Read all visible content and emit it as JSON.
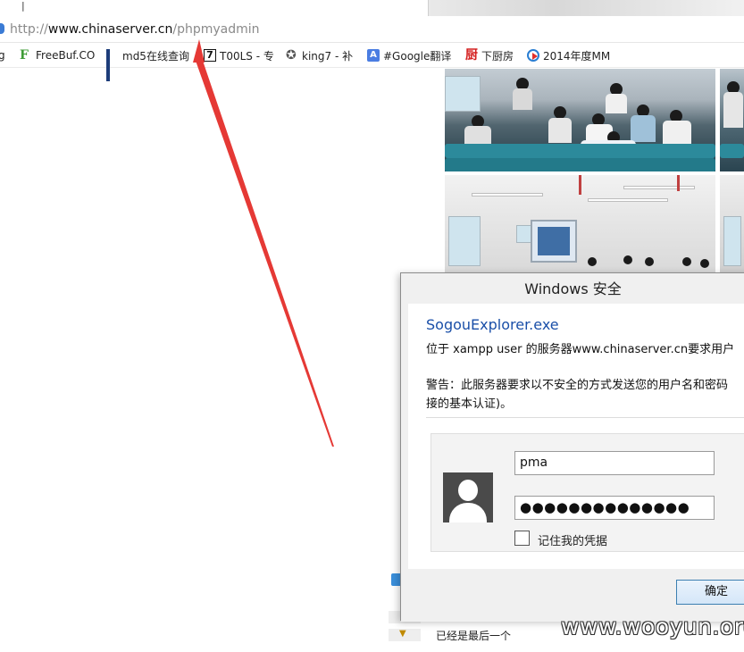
{
  "browser": {
    "tab_fragment": "|",
    "address_bar": {
      "url_prefix": "http://",
      "url_host": "www.chinaserver.cn",
      "url_path": "/phpmyadmin"
    },
    "bookmarks": [
      {
        "label": "g",
        "icon": "none"
      },
      {
        "label": "FreeBuf.CO",
        "icon": "freebuf-icon"
      },
      {
        "label": "md5在线查询",
        "icon": "md5-grid-icon"
      },
      {
        "label": "T00LS - 专",
        "icon": "t00ls-7-icon"
      },
      {
        "label": "king7 - 补",
        "icon": "star-icon"
      },
      {
        "label": "#Google翻译",
        "icon": "translate-icon"
      },
      {
        "label": "下厨房",
        "icon": "xiachufang-icon"
      },
      {
        "label": "2014年度MM",
        "icon": "play-circle-icon"
      }
    ]
  },
  "side_list": {
    "last_item_label": "已经是最后一个"
  },
  "dialog": {
    "title": "Windows 安全",
    "app_name": "SogouExplorer.exe",
    "message": "位于 xampp user 的服务器www.chinaserver.cn要求用户",
    "warning_line1": "警告：此服务器要求以不安全的方式发送您的用户名和密码",
    "warning_line2": "接的基本认证)。",
    "username_value": "pma",
    "password_value": "●●●●●●●●●●●●●●",
    "remember_label": "记住我的凭据",
    "ok_label": "确定"
  },
  "watermark": "www.wooyun.org",
  "colors": {
    "arrow": "#e53935",
    "dialog_link": "#1a4fa8",
    "ok_border": "#3c7fb1"
  }
}
